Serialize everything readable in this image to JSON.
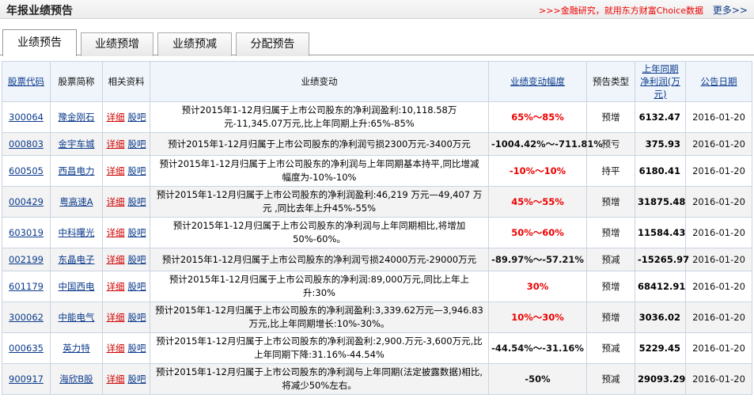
{
  "header": {
    "title": "年报业绩预告",
    "promo": ">>>金融研究，就用东方财富Choice数据",
    "more": "更多>>"
  },
  "tabs": [
    {
      "label": "业绩预告",
      "active": true
    },
    {
      "label": "业绩预增",
      "active": false
    },
    {
      "label": "业绩预减",
      "active": false
    },
    {
      "label": "分配预告",
      "active": false
    }
  ],
  "columns": {
    "code": "股票代码",
    "name": "股票简称",
    "related": "相关资料",
    "change": "业绩变动",
    "range": "业绩变动幅度",
    "type": "预告类型",
    "prev_profit": "上年同期净利润(万元)",
    "date": "公告日期"
  },
  "link_labels": {
    "detail": "详细",
    "bar": "股吧"
  },
  "rows": [
    {
      "code": "300064",
      "name": "豫金刚石",
      "change": "预计2015年1-12月归属于上市公司股东的净利润盈利:10,118.58万元-11,345.07万元,比上年同期上升:65%-85%",
      "range": "65%～85%",
      "type": "预增",
      "prev_profit": "6132.47",
      "date": "2016-01-20"
    },
    {
      "code": "000803",
      "name": "金宇车城",
      "change": "预计2015年1-12月归属于上市公司股东的净利润亏损2300万元-3400万元",
      "range": "-1004.42%～-711.81%",
      "type": "预亏",
      "prev_profit": "375.93",
      "date": "2016-01-20"
    },
    {
      "code": "600505",
      "name": "西昌电力",
      "change": "预计2015年1-12月归属于上市公司股东的净利润与上年同期基本持平,同比增减幅度为-10%-10%",
      "range": "-10%～10%",
      "type": "持平",
      "prev_profit": "6180.41",
      "date": "2016-01-20"
    },
    {
      "code": "000429",
      "name": "粤高速A",
      "change": "预计2015年1-12月归属于上市公司股东的净利润盈利:46,219 万元—49,407 万元 ,同比去年上升45%-55%",
      "range": "45%～55%",
      "type": "预增",
      "prev_profit": "31875.48",
      "date": "2016-01-20"
    },
    {
      "code": "603019",
      "name": "中科曙光",
      "change": "预计2015年1-12月归属于上市公司股东的净利润与上年同期相比,将增加50%-60%。",
      "range": "50%～60%",
      "type": "预增",
      "prev_profit": "11584.43",
      "date": "2016-01-20"
    },
    {
      "code": "002199",
      "name": "东晶电子",
      "change": "预计2015年1-12月归属于上市公司股东的净利润亏损24000万元-29000万元",
      "range": "-89.97%～-57.21%",
      "type": "预减",
      "prev_profit": "-15265.97",
      "date": "2016-01-20"
    },
    {
      "code": "601179",
      "name": "中国西电",
      "change": "预计2015年1-12月归属于上市公司股东的净利润:89,000万元,同比上年上升:30%",
      "range": "30%",
      "type": "预增",
      "prev_profit": "68412.91",
      "date": "2016-01-20"
    },
    {
      "code": "300062",
      "name": "中能电气",
      "change": "预计2015年1-12月归属于上市公司股东的净利润盈利:3,339.62万元—3,946.83万元,比上年同期增长:10%-30%。",
      "range": "10%～30%",
      "type": "预增",
      "prev_profit": "3036.02",
      "date": "2016-01-20"
    },
    {
      "code": "000635",
      "name": "英力特",
      "change": "预计2015年1-12月归属于上市公司股东的净利润盈利:2,900.万元-3,600万元,比上年同期下降:31.16%-44.54%",
      "range": "-44.54%～-31.16%",
      "type": "预减",
      "prev_profit": "5229.45",
      "date": "2016-01-20"
    },
    {
      "code": "900917",
      "name": "海欣B股",
      "change": "预计2015年1-12月归属于上市公司股东的净利润与上年同期(法定披露数据)相比,将减少50%左右。",
      "range": "-50%",
      "type": "预减",
      "prev_profit": "29093.29",
      "date": "2016-01-20"
    }
  ],
  "colors": {
    "accent_red": "#e00000",
    "link_blue": "#0b3b8c"
  }
}
